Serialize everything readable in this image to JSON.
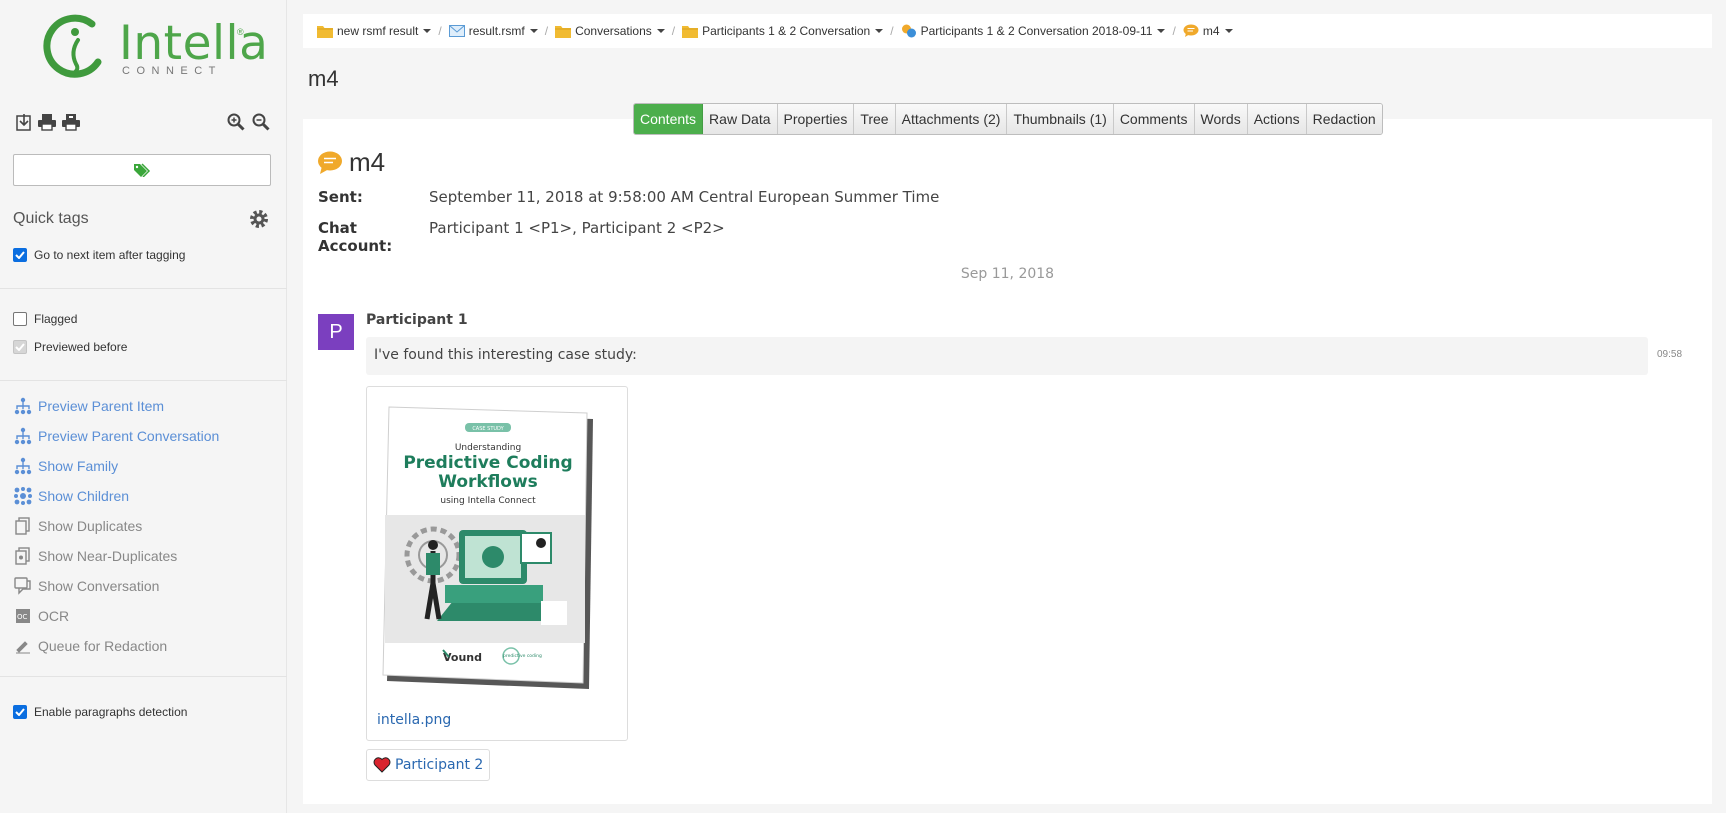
{
  "logo": {
    "name": "Intella",
    "sub": "CONNECT",
    "reg": "®"
  },
  "sidebar": {
    "toolbar": {
      "icons": [
        "download-icon",
        "print-icon",
        "print-alt-icon",
        "zoom-in-icon",
        "zoom-out-icon"
      ]
    },
    "tag_input_icon": "tag-icon",
    "quick_tags": {
      "label": "Quick tags",
      "gear": "gear-icon"
    },
    "checkboxes": {
      "go_next": {
        "label": "Go to next item after tagging",
        "checked": true
      },
      "flagged": {
        "label": "Flagged",
        "checked": false
      },
      "previewed": {
        "label": "Previewed before",
        "checked": true
      },
      "paragraphs": {
        "label": "Enable paragraphs detection",
        "checked": true
      }
    },
    "actions": [
      {
        "label": "Preview Parent Item",
        "icon": "hierarchy-icon",
        "enabled": true
      },
      {
        "label": "Preview Parent Conversation",
        "icon": "hierarchy-icon",
        "enabled": true
      },
      {
        "label": "Show Family",
        "icon": "hierarchy-icon",
        "enabled": true
      },
      {
        "label": "Show Children",
        "icon": "children-icon",
        "enabled": true
      },
      {
        "label": "Show Duplicates",
        "icon": "duplicates-icon",
        "enabled": false
      },
      {
        "label": "Show Near-Duplicates",
        "icon": "near-duplicates-icon",
        "enabled": false
      },
      {
        "label": "Show Conversation",
        "icon": "conversation-icon",
        "enabled": false
      },
      {
        "label": "OCR",
        "icon": "ocr-icon",
        "enabled": false
      },
      {
        "label": "Queue for Redaction",
        "icon": "redaction-icon",
        "enabled": false
      }
    ]
  },
  "breadcrumb": [
    {
      "label": "new rsmf result",
      "icon": "folder-icon"
    },
    {
      "label": "result.rsmf",
      "icon": "email-icon"
    },
    {
      "label": "Conversations",
      "icon": "folder-icon"
    },
    {
      "label": "Participants 1 & 2 Conversation",
      "icon": "folder-icon"
    },
    {
      "label": "Participants 1 & 2 Conversation 2018-09-11",
      "icon": "conversation-icon"
    },
    {
      "label": "m4",
      "icon": "chat-message-icon"
    }
  ],
  "page_title": "m4",
  "tabs": [
    {
      "label": "Contents",
      "active": true
    },
    {
      "label": "Raw Data",
      "active": false
    },
    {
      "label": "Properties",
      "active": false
    },
    {
      "label": "Tree",
      "active": false
    },
    {
      "label": "Attachments (2)",
      "active": false
    },
    {
      "label": "Thumbnails (1)",
      "active": false
    },
    {
      "label": "Comments",
      "active": false
    },
    {
      "label": "Words",
      "active": false
    },
    {
      "label": "Actions",
      "active": false
    },
    {
      "label": "Redaction",
      "active": false
    }
  ],
  "message": {
    "title": "m4",
    "meta": [
      {
        "key": "Sent:",
        "value": "September 11, 2018 at 9:58:00 AM Central European Summer Time"
      },
      {
        "key": "Chat Account:",
        "value": "Participant 1 <P1>, Participant 2 <P2>"
      }
    ],
    "date_divider": "Sep 11, 2018",
    "avatar_letter": "P",
    "sender": "Participant 1",
    "text": "I've found this interesting case study:",
    "time": "09:58",
    "attachment": {
      "filename": "intella.png",
      "cover": {
        "badge": "CASE STUDY",
        "line1": "Understanding",
        "line2": "Predictive Coding",
        "line3": "Workflows",
        "line4": "using Intella Connect",
        "brand": "Vound",
        "brand2": "predictive coding"
      }
    },
    "reaction": {
      "name": "Participant 2",
      "icon": "heart-icon"
    }
  },
  "colors": {
    "accent": "#4cae4c",
    "link": "#2a68b0",
    "avatar": "#7b3fbf",
    "sidebar_link": "#5b8fd6"
  }
}
